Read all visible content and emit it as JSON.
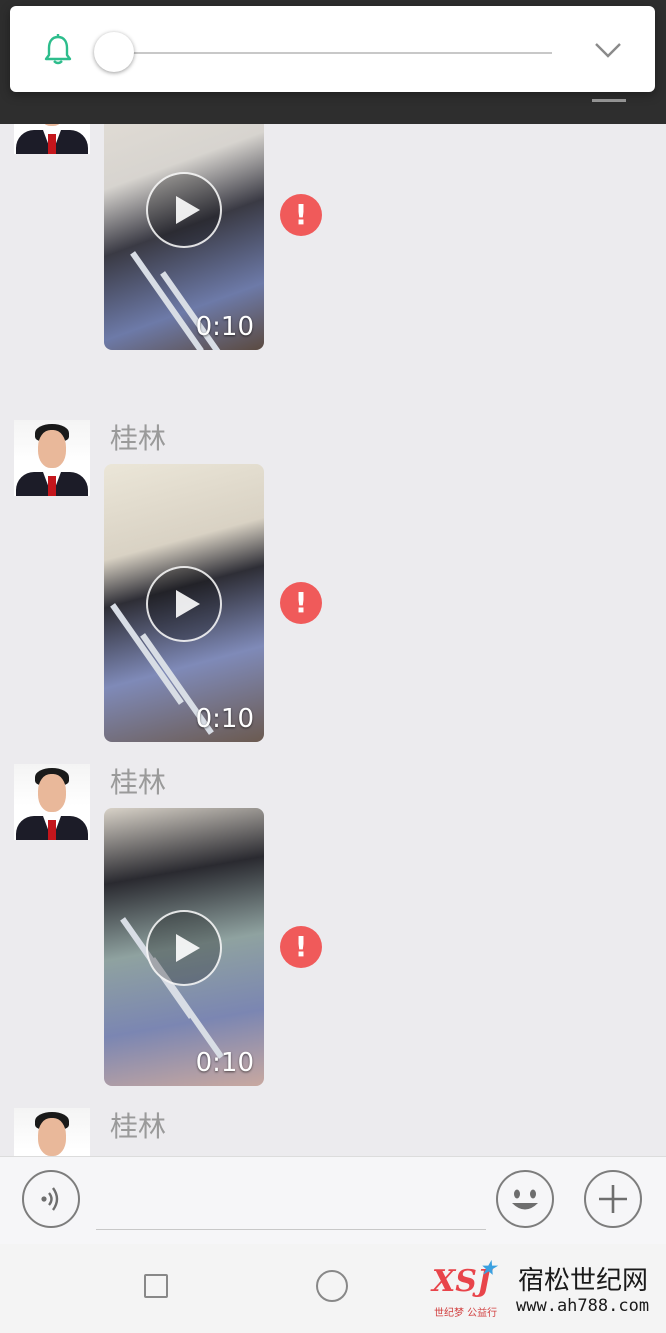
{
  "header": {
    "title": ""
  },
  "volume_overlay": {
    "level": 0
  },
  "messages": [
    {
      "sender": "",
      "duration": "0:10",
      "status": "!"
    },
    {
      "sender": "桂林",
      "duration": "0:10",
      "status": "!"
    },
    {
      "sender": "桂林",
      "duration": "0:10",
      "status": "!"
    },
    {
      "sender": "桂林"
    }
  ],
  "input": {
    "placeholder": ""
  },
  "watermark": {
    "logo": "XSJ",
    "sub": "世纪梦 公益行",
    "name": "宿松世纪网",
    "url": "www.ah788.com"
  },
  "colors": {
    "error": "#f05a5a",
    "accent": "#2dbd8c"
  }
}
